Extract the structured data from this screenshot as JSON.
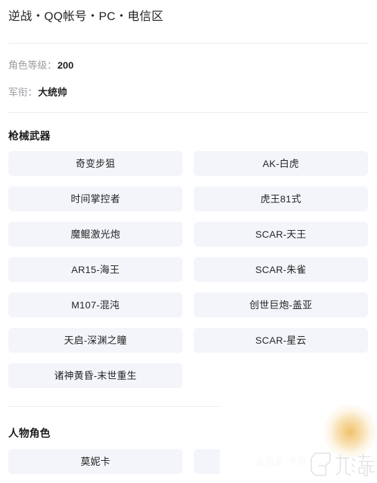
{
  "header": {
    "title": "逆战・QQ帐号・PC・电信区"
  },
  "info": {
    "rows": [
      {
        "label": "角色等级：",
        "value": "200"
      },
      {
        "label": "军衔：",
        "value": "大统帅"
      }
    ]
  },
  "sections": [
    {
      "heading": "枪械武器",
      "tiles": [
        "奇变步狙",
        "AK-白虎",
        "时间掌控者",
        "虎王81式",
        "魔鲲激光炮",
        "SCAR-天王",
        "AR15-海王",
        "SCAR-朱雀",
        "M107-混沌",
        "创世巨炮-盖亚",
        "天启-深渊之瞳",
        "SCAR-星云",
        "诸神黄昏-末世重生"
      ]
    },
    {
      "heading": "人物角色",
      "tiles": [
        "莫妮卡",
        "追猎者-卡罗"
      ]
    }
  ],
  "watermark": {
    "brand": "九游"
  },
  "colors": {
    "page_background": "#ffffff",
    "tile_background": "#f3f5fa",
    "tile_text": "#242424",
    "label_text": "#9b9ba1",
    "heading_text": "#1b1b1b",
    "divider": "#ececee",
    "glow_accent": "#e9a82d",
    "watermark_outline": "#e2e2e4"
  }
}
